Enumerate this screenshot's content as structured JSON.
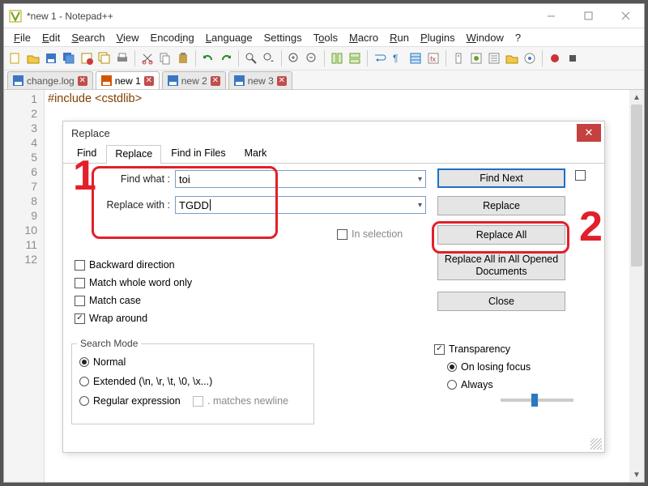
{
  "window": {
    "title": "*new 1 - Notepad++"
  },
  "menu": {
    "file": "File",
    "edit": "Edit",
    "search": "Search",
    "view": "View",
    "encoding": "Encoding",
    "language": "Language",
    "settings": "Settings",
    "tools": "Tools",
    "macro": "Macro",
    "run": "Run",
    "plugins": "Plugins",
    "window": "Window",
    "help": "?"
  },
  "tabs": [
    {
      "label": "change.log",
      "dirty": false,
      "active": false
    },
    {
      "label": "new 1",
      "dirty": true,
      "active": true
    },
    {
      "label": "new 2",
      "dirty": false,
      "active": false
    },
    {
      "label": "new 3",
      "dirty": false,
      "active": false
    }
  ],
  "editor": {
    "lines": [
      "1",
      "2",
      "3",
      "4",
      "5",
      "6",
      "7",
      "8",
      "9",
      "10",
      "11",
      "12"
    ],
    "code_prefix": "#include ",
    "code_hdr": "<cstdlib>"
  },
  "dialog": {
    "title": "Replace",
    "tabs": {
      "find": "Find",
      "replace": "Replace",
      "findinfiles": "Find in Files",
      "mark": "Mark"
    },
    "find_label": "Find what :",
    "find_value": "toi",
    "replace_label": "Replace with :",
    "replace_value": "TGDD",
    "in_selection": "In selection",
    "btn_find_next": "Find Next",
    "btn_replace": "Replace",
    "btn_replace_all": "Replace All",
    "btn_replace_all_opened": "Replace All in All Opened Documents",
    "btn_close": "Close",
    "chk_backward": "Backward direction",
    "chk_whole": "Match whole word only",
    "chk_case": "Match case",
    "chk_wrap": "Wrap around",
    "search_mode": {
      "legend": "Search Mode",
      "normal": "Normal",
      "extended": "Extended (\\n, \\r, \\t, \\0, \\x...)",
      "regex": "Regular expression",
      "matches_newline": ". matches newline"
    },
    "transparency": {
      "label": "Transparency",
      "on_losing": "On losing focus",
      "always": "Always"
    }
  },
  "annotations": {
    "one": "1",
    "two": "2"
  }
}
